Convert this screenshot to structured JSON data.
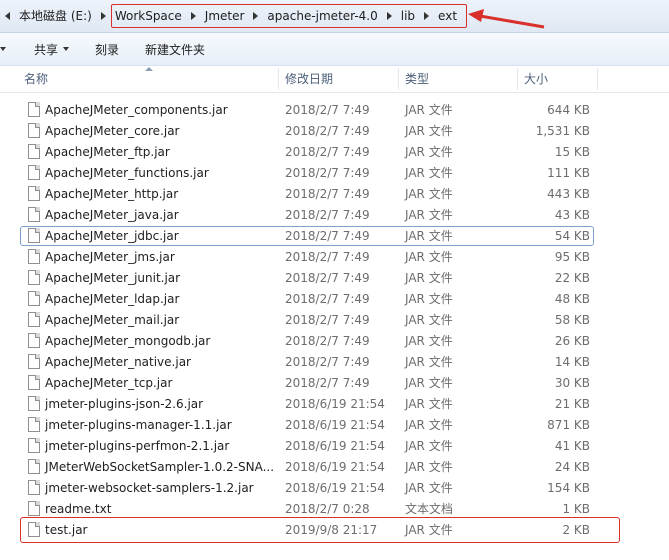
{
  "address": {
    "crumbs": [
      "本地磁盘 (E:)",
      "WorkSpace",
      "Jmeter",
      "apache-jmeter-4.0",
      "lib",
      "ext"
    ]
  },
  "toolbar": {
    "share": "共享",
    "burn": "刻录",
    "new_folder": "新建文件夹"
  },
  "columns": {
    "name": "名称",
    "date": "修改日期",
    "type": "类型",
    "size": "大小"
  },
  "files": [
    {
      "name": "ApacheJMeter_components.jar",
      "date": "2018/2/7 7:49",
      "type": "JAR 文件",
      "size": "644 KB"
    },
    {
      "name": "ApacheJMeter_core.jar",
      "date": "2018/2/7 7:49",
      "type": "JAR 文件",
      "size": "1,531 KB"
    },
    {
      "name": "ApacheJMeter_ftp.jar",
      "date": "2018/2/7 7:49",
      "type": "JAR 文件",
      "size": "15 KB"
    },
    {
      "name": "ApacheJMeter_functions.jar",
      "date": "2018/2/7 7:49",
      "type": "JAR 文件",
      "size": "111 KB"
    },
    {
      "name": "ApacheJMeter_http.jar",
      "date": "2018/2/7 7:49",
      "type": "JAR 文件",
      "size": "443 KB"
    },
    {
      "name": "ApacheJMeter_java.jar",
      "date": "2018/2/7 7:49",
      "type": "JAR 文件",
      "size": "43 KB"
    },
    {
      "name": "ApacheJMeter_jdbc.jar",
      "date": "2018/2/7 7:49",
      "type": "JAR 文件",
      "size": "54 KB"
    },
    {
      "name": "ApacheJMeter_jms.jar",
      "date": "2018/2/7 7:49",
      "type": "JAR 文件",
      "size": "95 KB"
    },
    {
      "name": "ApacheJMeter_junit.jar",
      "date": "2018/2/7 7:49",
      "type": "JAR 文件",
      "size": "22 KB"
    },
    {
      "name": "ApacheJMeter_ldap.jar",
      "date": "2018/2/7 7:49",
      "type": "JAR 文件",
      "size": "48 KB"
    },
    {
      "name": "ApacheJMeter_mail.jar",
      "date": "2018/2/7 7:49",
      "type": "JAR 文件",
      "size": "58 KB"
    },
    {
      "name": "ApacheJMeter_mongodb.jar",
      "date": "2018/2/7 7:49",
      "type": "JAR 文件",
      "size": "26 KB"
    },
    {
      "name": "ApacheJMeter_native.jar",
      "date": "2018/2/7 7:49",
      "type": "JAR 文件",
      "size": "14 KB"
    },
    {
      "name": "ApacheJMeter_tcp.jar",
      "date": "2018/2/7 7:49",
      "type": "JAR 文件",
      "size": "30 KB"
    },
    {
      "name": "jmeter-plugins-json-2.6.jar",
      "date": "2018/6/19 21:54",
      "type": "JAR 文件",
      "size": "21 KB"
    },
    {
      "name": "jmeter-plugins-manager-1.1.jar",
      "date": "2018/6/19 21:54",
      "type": "JAR 文件",
      "size": "871 KB"
    },
    {
      "name": "jmeter-plugins-perfmon-2.1.jar",
      "date": "2018/6/19 21:54",
      "type": "JAR 文件",
      "size": "41 KB"
    },
    {
      "name": "JMeterWebSocketSampler-1.0.2-SNA...",
      "date": "2018/6/19 21:54",
      "type": "JAR 文件",
      "size": "24 KB"
    },
    {
      "name": "jmeter-websocket-samplers-1.2.jar",
      "date": "2018/6/19 21:54",
      "type": "JAR 文件",
      "size": "154 KB"
    },
    {
      "name": "readme.txt",
      "date": "2018/2/7 0:28",
      "type": "文本文档",
      "size": "1 KB"
    },
    {
      "name": "test.jar",
      "date": "2019/9/8 21:17",
      "type": "JAR 文件",
      "size": "2 KB"
    }
  ],
  "focused_index": 6,
  "marked_index": 20,
  "colors": {
    "annotation": "#d9302b",
    "focus": "#7da2ce"
  }
}
